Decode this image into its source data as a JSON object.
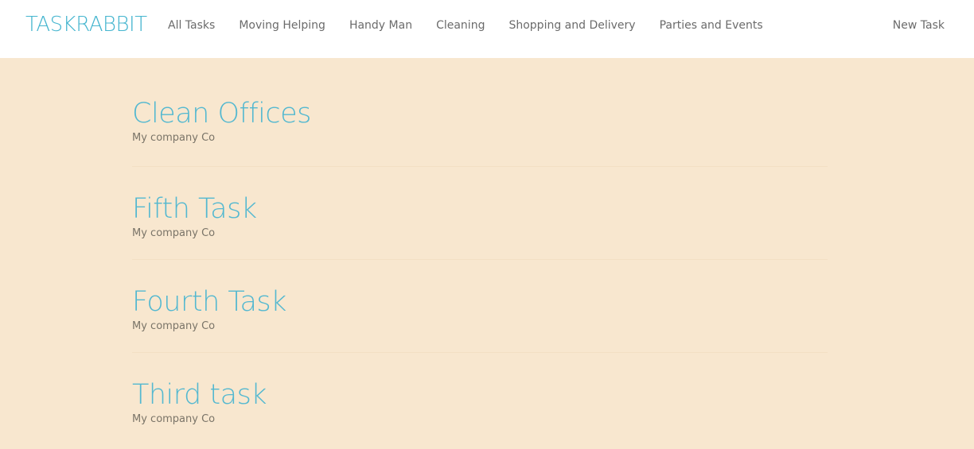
{
  "navbar": {
    "brand": "TASKRABBIT",
    "links": [
      "All Tasks",
      "Moving Helping",
      "Handy Man",
      "Cleaning",
      "Shopping and Delivery",
      "Parties and Events"
    ],
    "new_task": "New Task"
  },
  "tasks": [
    {
      "title": "Clean Offices",
      "company": "My company Co"
    },
    {
      "title": "Fifth Task",
      "company": "My company Co"
    },
    {
      "title": "Fourth Task",
      "company": "My company Co"
    },
    {
      "title": "Third task",
      "company": "My company Co"
    }
  ],
  "colors": {
    "accent": "#45b5cf",
    "background": "#f8e7cf"
  }
}
